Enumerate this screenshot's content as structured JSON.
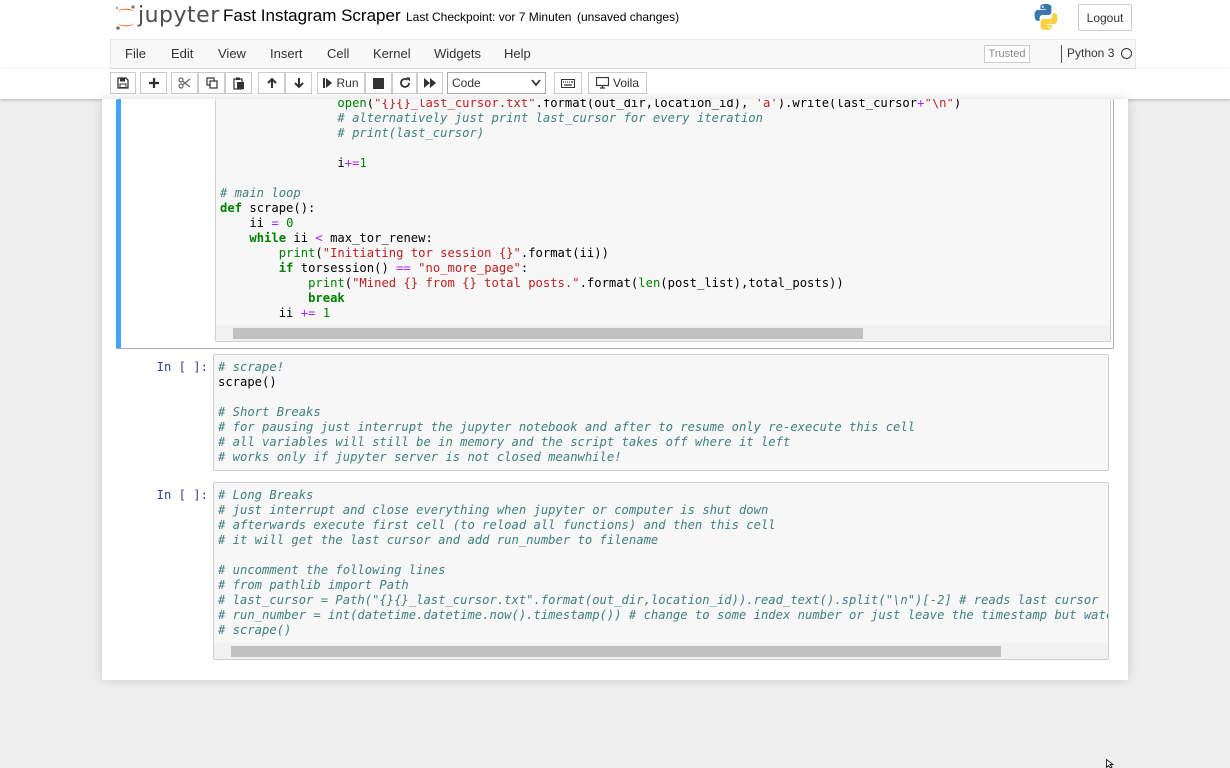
{
  "header": {
    "logo_text": "jupyter",
    "notebook_name": "Fast Instagram Scraper",
    "checkpoint": "Last Checkpoint: vor 7 Minuten",
    "autosave": "(unsaved changes)",
    "logout_label": "Logout"
  },
  "menu": {
    "items": [
      "File",
      "Edit",
      "View",
      "Insert",
      "Cell",
      "Kernel",
      "Widgets",
      "Help"
    ],
    "trusted": "Trusted",
    "kernel": "Python 3"
  },
  "toolbar": {
    "run_label": "Run",
    "cell_type": "Code",
    "voila_label": "Voila"
  },
  "cells": [
    {
      "prompt": "",
      "lines": [
        "                open(\"{}{}_last_cursor.txt\".format(out_dir,location_id), 'a').write(last_cursor+\"\\n\")",
        "                # alternatively just print last_cursor for every iteration",
        "                # print(last_cursor)",
        "",
        "                i+=1",
        "",
        "# main loop",
        "def scrape():",
        "    ii = 0",
        "    while ii < max_tor_renew:",
        "        print(\"Initiating tor session {}\".format(ii))",
        "        if torsession() == \"no_more_page\":",
        "            print(\"Mined {} from {} total posts.\".format(len(post_list),total_posts))",
        "            break",
        "        ii += 1"
      ]
    },
    {
      "prompt": "In [ ]:",
      "lines": [
        "# scrape!",
        "scrape()",
        "",
        "# Short Breaks",
        "# for pausing just interrupt the jupyter notebook and after to resume only re-execute this cell",
        "# all variables will still be in memory and the script takes off where it left",
        "# works only if jupyter server is not closed meanwhile!"
      ]
    },
    {
      "prompt": "In [ ]:",
      "lines": [
        "# Long Breaks",
        "# just interrupt and close everything when jupyter or computer is shut down",
        "# afterwards execute first cell (to reload all functions) and then this cell",
        "# it will get the last cursor and add run_number to filename",
        "",
        "# uncomment the following lines",
        "# from pathlib import Path",
        "# last_cursor = Path(\"{}{}_last_cursor.txt\".format(out_dir,location_id)).read_text().split(\"\\n\")[-2] # reads last cursor",
        "# run_number = int(datetime.datetime.now().timestamp()) # change to some index number or just leave the timestamp but watch out j",
        "# scrape()"
      ]
    }
  ],
  "colors": {
    "selected_cell": "#42a5f5",
    "prompt": "#303f9f",
    "comment": "#408080",
    "keyword": "#008000",
    "string": "#ba2121",
    "operator": "#aa22ff"
  }
}
